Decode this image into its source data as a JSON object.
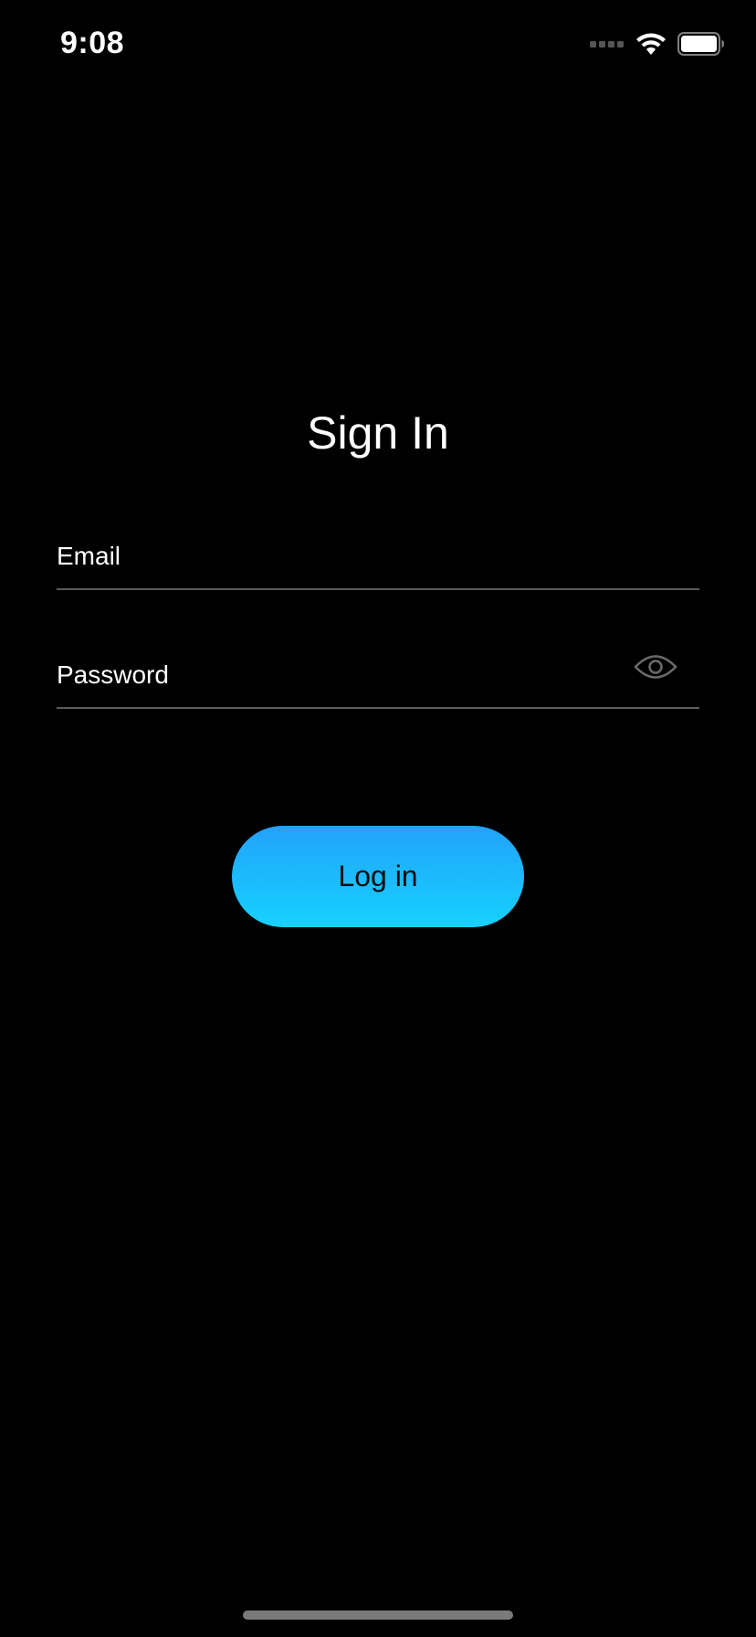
{
  "status_bar": {
    "time": "9:08",
    "signal_icon": "cellular-signal-icon",
    "wifi_icon": "wifi-icon",
    "battery_icon": "battery-icon"
  },
  "page": {
    "title": "Sign In"
  },
  "form": {
    "email_placeholder": "Email",
    "email_value": "",
    "password_placeholder": "Password",
    "password_value": "",
    "password_visibility_icon": "eye-icon",
    "login_label": "Log in"
  },
  "colors": {
    "background": "#000000",
    "text": "#ffffff",
    "underline": "#5a5a5a",
    "button_gradient_top": "#22a2fb",
    "button_gradient_bottom": "#16d2fe",
    "button_text": "#0d0d0d"
  }
}
